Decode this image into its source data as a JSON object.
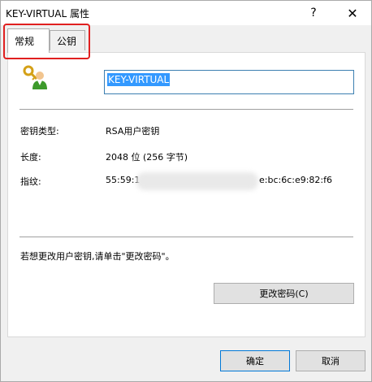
{
  "window": {
    "title": "KEY-VIRTUAL 属性",
    "help_label": "?",
    "close_label": "✕"
  },
  "tabs": [
    {
      "label": "常规",
      "active": true
    },
    {
      "label": "公钥",
      "active": false
    }
  ],
  "general": {
    "key_name": "KEY-VIRTUAL",
    "key_type_label": "密钥类型:",
    "key_type_value": "RSA用户密钥",
    "length_label": "长度:",
    "length_value": "2048 位 (256 字节)",
    "fingerprint_label": "指纹:",
    "fingerprint_start": "55:59:1",
    "fingerprint_end": "e:bc:6c:e9:82:f6",
    "hint": "若想更改用户密钥,请单击\"更改密码\"。",
    "change_password_button": "更改密码(C)"
  },
  "footer": {
    "ok_label": "确定",
    "cancel_label": "取消"
  },
  "icons": {
    "key_user_icon": "key-user-icon"
  },
  "colors": {
    "selection": "#3399ff",
    "highlight_border": "#e02020",
    "ok_border": "#0078d7"
  }
}
